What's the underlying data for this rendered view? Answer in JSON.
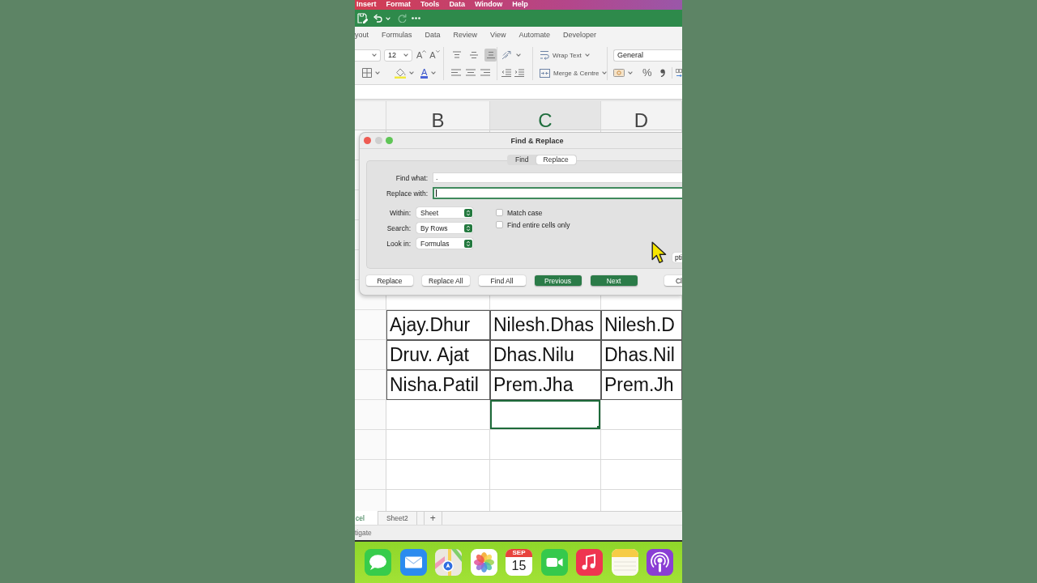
{
  "menu_bar": {
    "items": [
      "Insert",
      "Format",
      "Tools",
      "Data",
      "Window",
      "Help"
    ]
  },
  "quick_access": {
    "redo_disabled": true
  },
  "ribbon": {
    "tabs": [
      {
        "label": "yout",
        "selected": false
      },
      {
        "label": "Formulas",
        "selected": false
      },
      {
        "label": "Data",
        "selected": false
      },
      {
        "label": "Review",
        "selected": false
      },
      {
        "label": "View",
        "selected": false
      },
      {
        "label": "Automate",
        "selected": false
      },
      {
        "label": "Developer",
        "selected": false
      }
    ],
    "font_size": "12",
    "grow_font": "A",
    "shrink_font": "A",
    "vertical_align": [
      {
        "selected": false
      },
      {
        "selected": false
      },
      {
        "selected": true
      }
    ],
    "wrap_text": "Wrap Text",
    "number_format": "General",
    "font_color": "A",
    "merge": "Merge & Centre",
    "percent": "%"
  },
  "sheet": {
    "columns": [
      {
        "label": "B",
        "selected": false
      },
      {
        "label": "C",
        "selected": true
      },
      {
        "label": "D",
        "selected": false
      }
    ],
    "rows": [
      {
        "cells": [
          {
            "text": "Ajay.Dhur",
            "selected": false
          },
          {
            "text": "Nilesh.Dhas",
            "selected": false
          },
          {
            "text": "Nilesh.D",
            "selected": false
          }
        ]
      },
      {
        "cells": [
          {
            "text": "Druv. Ajat",
            "selected": false
          },
          {
            "text": "Dhas.Nilu",
            "selected": false
          },
          {
            "text": "Dhas.Nil",
            "selected": false
          }
        ]
      },
      {
        "cells": [
          {
            "text": "Nisha.Patil",
            "selected": false
          },
          {
            "text": "Prem.Jha",
            "selected": false
          },
          {
            "text": "Prem.Jh",
            "selected": false
          }
        ]
      },
      {
        "cells": [
          {
            "selected": false
          },
          {
            "selected": true
          },
          {
            "selected": false
          }
        ]
      }
    ],
    "tabs": [
      {
        "label": "cel",
        "selected": true
      },
      {
        "label": "Sheet2",
        "selected": false
      }
    ],
    "add_sheet": "+"
  },
  "status_bar": {
    "text": "tigate"
  },
  "dialog": {
    "title": "Find & Replace",
    "window_controls": [
      {
        "kind": "close",
        "disabled": false
      },
      {
        "kind": "minimize",
        "disabled": true
      },
      {
        "kind": "zoom",
        "disabled": false
      }
    ],
    "modes": [
      {
        "label": "Find",
        "selected": false
      },
      {
        "label": "Replace",
        "selected": true
      }
    ],
    "fields": [
      {
        "label": "Find what:",
        "value": ".",
        "focused": false
      },
      {
        "label": "Replace with:",
        "focused": true
      }
    ],
    "selects": [
      {
        "label": "Within:",
        "value": "Sheet"
      },
      {
        "label": "Search:",
        "value": "By Rows"
      },
      {
        "label": "Look in:",
        "value": "Formulas"
      }
    ],
    "checkboxes": [
      {
        "label": "Match case",
        "checked": false
      },
      {
        "label": "Find entire cells only",
        "checked": false
      }
    ],
    "options_button": "pti",
    "buttons": [
      {
        "label": "Replace",
        "kind": "default"
      },
      {
        "label": "Replace All",
        "kind": "default"
      },
      {
        "label": "Find All",
        "kind": "default"
      },
      {
        "label": "Previous",
        "kind": "primary"
      },
      {
        "label": "Next",
        "kind": "primary"
      },
      {
        "label": "Cl",
        "kind": "default"
      }
    ]
  },
  "dock": {
    "calendar": {
      "month": "SEP",
      "day": "15"
    }
  }
}
